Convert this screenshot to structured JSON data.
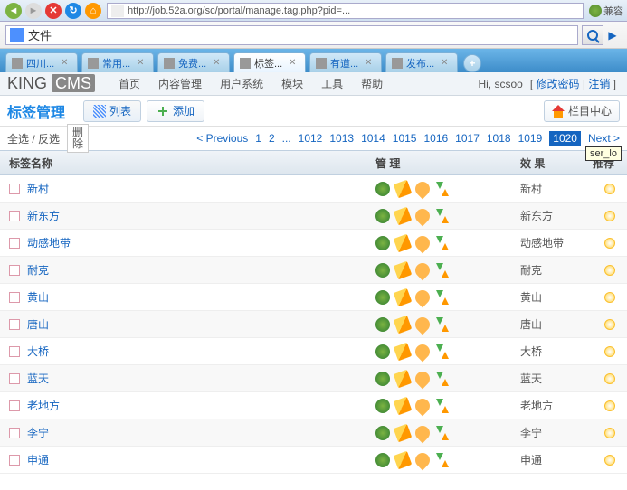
{
  "browser": {
    "url": "http://job.52a.org/sc/portal/manage.tag.php?pid=...",
    "compat_label": "兼容",
    "addr_text": "文件"
  },
  "tabs": [
    {
      "label": "四川..."
    },
    {
      "label": "常用..."
    },
    {
      "label": "免费..."
    },
    {
      "label": "标签...",
      "active": true
    },
    {
      "label": "有道..."
    },
    {
      "label": "发布..."
    }
  ],
  "logo": {
    "part1": "KING",
    "part2": "CMS"
  },
  "nav": [
    "首页",
    "内容管理",
    "用户系统",
    "模块",
    "工具",
    "帮助"
  ],
  "user_greeting": "Hi, scsoo",
  "user_actions": {
    "change_pwd": "修改密码",
    "logout": "注销"
  },
  "page_title": "标签管理",
  "buttons": {
    "list": "列表",
    "add": "添加",
    "col_center": "栏目中心"
  },
  "select_ctrl": {
    "label": "全选 / 反选",
    "delete": "删\n除"
  },
  "pager": {
    "prev": "< Previous",
    "first": [
      "1",
      "2"
    ],
    "ellipsis": "...",
    "pages": [
      "1012",
      "1013",
      "1014",
      "1015",
      "1016",
      "1017",
      "1018",
      "1019",
      "1020"
    ],
    "current": "1020",
    "next": "Next >",
    "tooltip": "ser_lo"
  },
  "columns": {
    "name": "标签名称",
    "manage": "管 理",
    "effect": "效 果",
    "recommend": "推荐"
  },
  "rows": [
    {
      "name": "新村",
      "effect": "新村"
    },
    {
      "name": "新东方",
      "effect": "新东方"
    },
    {
      "name": "动感地带",
      "effect": "动感地带"
    },
    {
      "name": "耐克",
      "effect": "耐克"
    },
    {
      "name": "黄山",
      "effect": "黄山"
    },
    {
      "name": "唐山",
      "effect": "唐山"
    },
    {
      "name": "大桥",
      "effect": "大桥"
    },
    {
      "name": "蓝天",
      "effect": "蓝天"
    },
    {
      "name": "老地方",
      "effect": "老地方"
    },
    {
      "name": "李宁",
      "effect": "李宁"
    },
    {
      "name": "申通",
      "effect": "申通"
    }
  ]
}
